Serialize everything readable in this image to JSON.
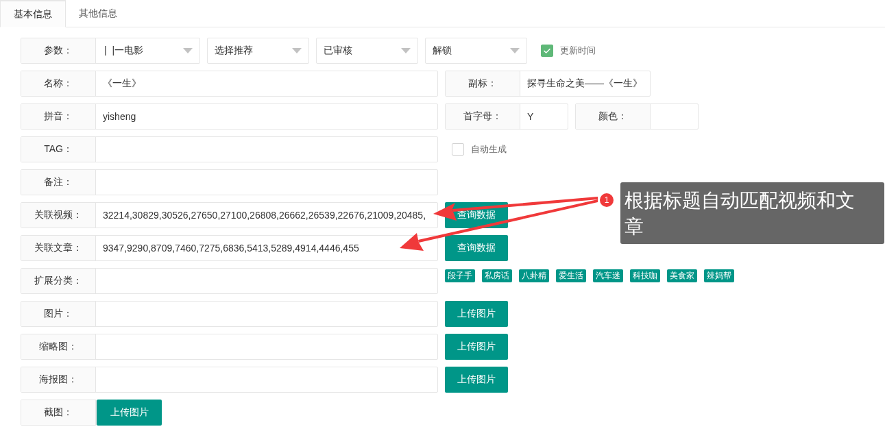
{
  "tabs": [
    {
      "label": "基本信息",
      "selected": true
    },
    {
      "label": "其他信息",
      "selected": false
    }
  ],
  "rows": [
    {
      "kind": "params",
      "label": "参数：",
      "selects": [
        "|  |一电影",
        "选择推荐",
        "已审核",
        "解锁"
      ],
      "extras": [
        {
          "kind": "checkbox",
          "label": "更新时间",
          "checked": true
        }
      ]
    },
    {
      "kind": "text",
      "label": "名称：",
      "value": "《一生》",
      "extras": [
        {
          "kind": "field",
          "label": "副标：",
          "value": "探寻生命之美——《一生》"
        }
      ]
    },
    {
      "kind": "text",
      "label": "拼音：",
      "value": "yisheng",
      "extras": [
        {
          "kind": "field",
          "label": "首字母：",
          "value": "Y"
        },
        {
          "kind": "field",
          "label": "颜色："
        }
      ]
    },
    {
      "kind": "text",
      "label": "TAG：",
      "extras": [
        {
          "kind": "checkbox",
          "label": "自动生成",
          "checked": false
        }
      ]
    },
    {
      "kind": "text",
      "label": "备注："
    },
    {
      "kind": "text",
      "label": "关联视频：",
      "value": "32214,30829,30526,27650,27100,26808,26662,26539,22676,21009,20485,",
      "extras": [
        {
          "kind": "button",
          "label": "查询数据"
        }
      ]
    },
    {
      "kind": "text",
      "label": "关联文章：",
      "value": "9347,9290,8709,7460,7275,6836,5413,5289,4914,4446,455",
      "extras": [
        {
          "kind": "button",
          "label": "查询数据"
        }
      ]
    },
    {
      "kind": "text",
      "label": "扩展分类：",
      "extras": [
        {
          "kind": "tags",
          "tags": [
            "段子手",
            "私房话",
            "八卦精",
            "爱生活",
            "汽车迷",
            "科技咖",
            "美食家",
            "辣妈帮"
          ]
        }
      ]
    },
    {
      "kind": "text",
      "label": "图片：",
      "extras": [
        {
          "kind": "button",
          "label": "上传图片"
        }
      ]
    },
    {
      "kind": "text",
      "label": "缩略图：",
      "extras": [
        {
          "kind": "button",
          "label": "上传图片"
        }
      ]
    },
    {
      "kind": "text",
      "label": "海报图：",
      "extras": [
        {
          "kind": "button",
          "label": "上传图片"
        }
      ]
    },
    {
      "kind": "upload",
      "label": "截图：",
      "button": "上传图片"
    }
  ],
  "annotation": {
    "badge": "1",
    "text": "根据标题自动匹配视频和文章"
  }
}
